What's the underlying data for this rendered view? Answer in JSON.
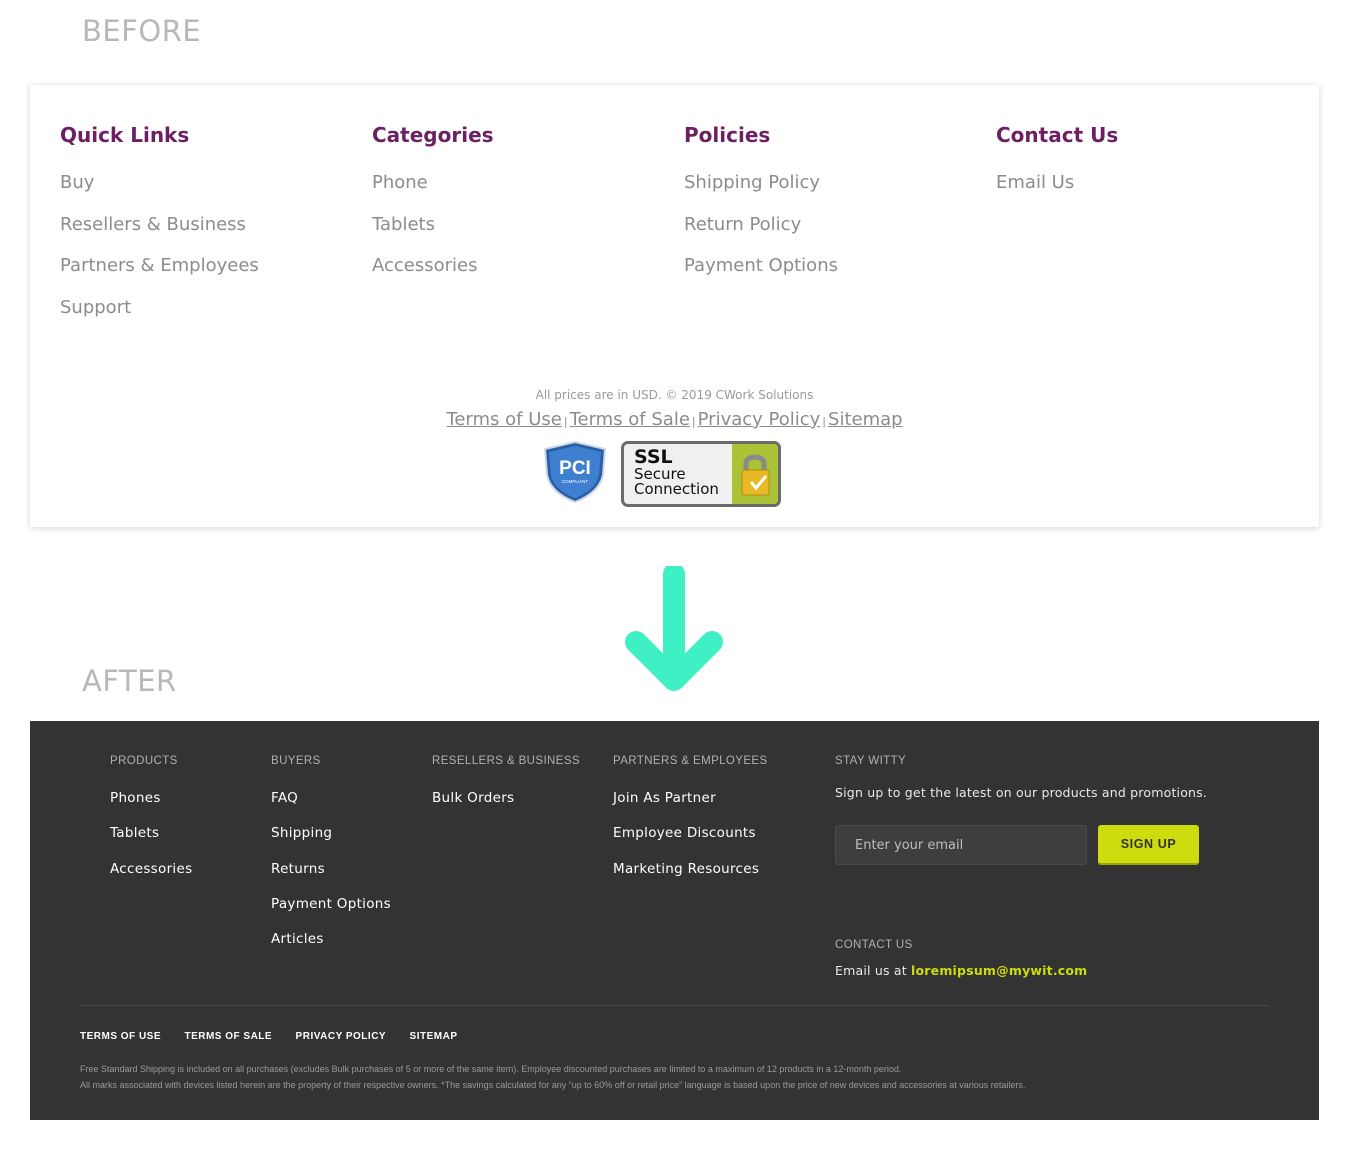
{
  "labels": {
    "before": "BEFORE",
    "after": "AFTER"
  },
  "before": {
    "columns": [
      {
        "title": "Quick Links",
        "items": [
          "Buy",
          "Resellers & Business",
          "Partners & Employees",
          "Support"
        ]
      },
      {
        "title": "Categories",
        "items": [
          "Phone",
          "Tablets",
          "Accessories"
        ]
      },
      {
        "title": "Policies",
        "items": [
          "Shipping Policy",
          "Return Policy",
          "Payment Options"
        ]
      },
      {
        "title": "Contact Us",
        "items": [
          "Email Us"
        ]
      }
    ],
    "copyright": "All prices are in USD. © 2019 CWork Solutions",
    "links": [
      "Terms of Use",
      "Terms of Sale",
      "Privacy Policy",
      "Sitemap"
    ],
    "separator": "|",
    "badges": {
      "pci": "PCI",
      "pci_sub": "COMPLIANT",
      "ssl_lines": [
        "SSL",
        "Secure",
        "Connection"
      ]
    },
    "colors": {
      "heading": "#6d1f63",
      "link": "#8c8c8c"
    }
  },
  "after": {
    "columns": [
      {
        "title": "PRODUCTS",
        "items": [
          "Phones",
          "Tablets",
          "Accessories"
        ]
      },
      {
        "title": "BUYERS",
        "items": [
          "FAQ",
          "Shipping",
          "Returns",
          "Payment Options",
          "Articles"
        ]
      },
      {
        "title": "RESELLERS & BUSINESS",
        "items": [
          "Bulk Orders"
        ]
      },
      {
        "title": "PARTNERS & EMPLOYEES",
        "items": [
          "Join As Partner",
          "Employee Discounts",
          "Marketing Resources"
        ]
      }
    ],
    "newsletter": {
      "title": "STAY WITTY",
      "description": "Sign up to get the latest on our products and promotions.",
      "placeholder": "Enter your email",
      "button": "SIGN UP"
    },
    "contact": {
      "title": "CONTACT US",
      "prefix": "Email us at",
      "email": "loremipsum@mywit.com"
    },
    "legal_links": [
      "TERMS OF USE",
      "TERMS OF SALE",
      "PRIVACY POLICY",
      "SITEMAP"
    ],
    "fine_print": [
      "Free Standard Shipping is included on all purchases (excludes Bulk purchases of 5 or more of the same item). Employee discounted purchases are limited to a maximum of 12 products in a 12-month period.",
      "All marks associated with devices listed herein are the property of their respective owners. *The savings calculated for any “up to 60% off or retail price” language is based upon the price of new devices and accessories at various retailers."
    ],
    "colors": {
      "background": "#333333",
      "accent": "#cddc0f"
    }
  },
  "icons": {
    "arrow": "arrow-down-icon",
    "arrow_color": "#3ff0c4"
  }
}
